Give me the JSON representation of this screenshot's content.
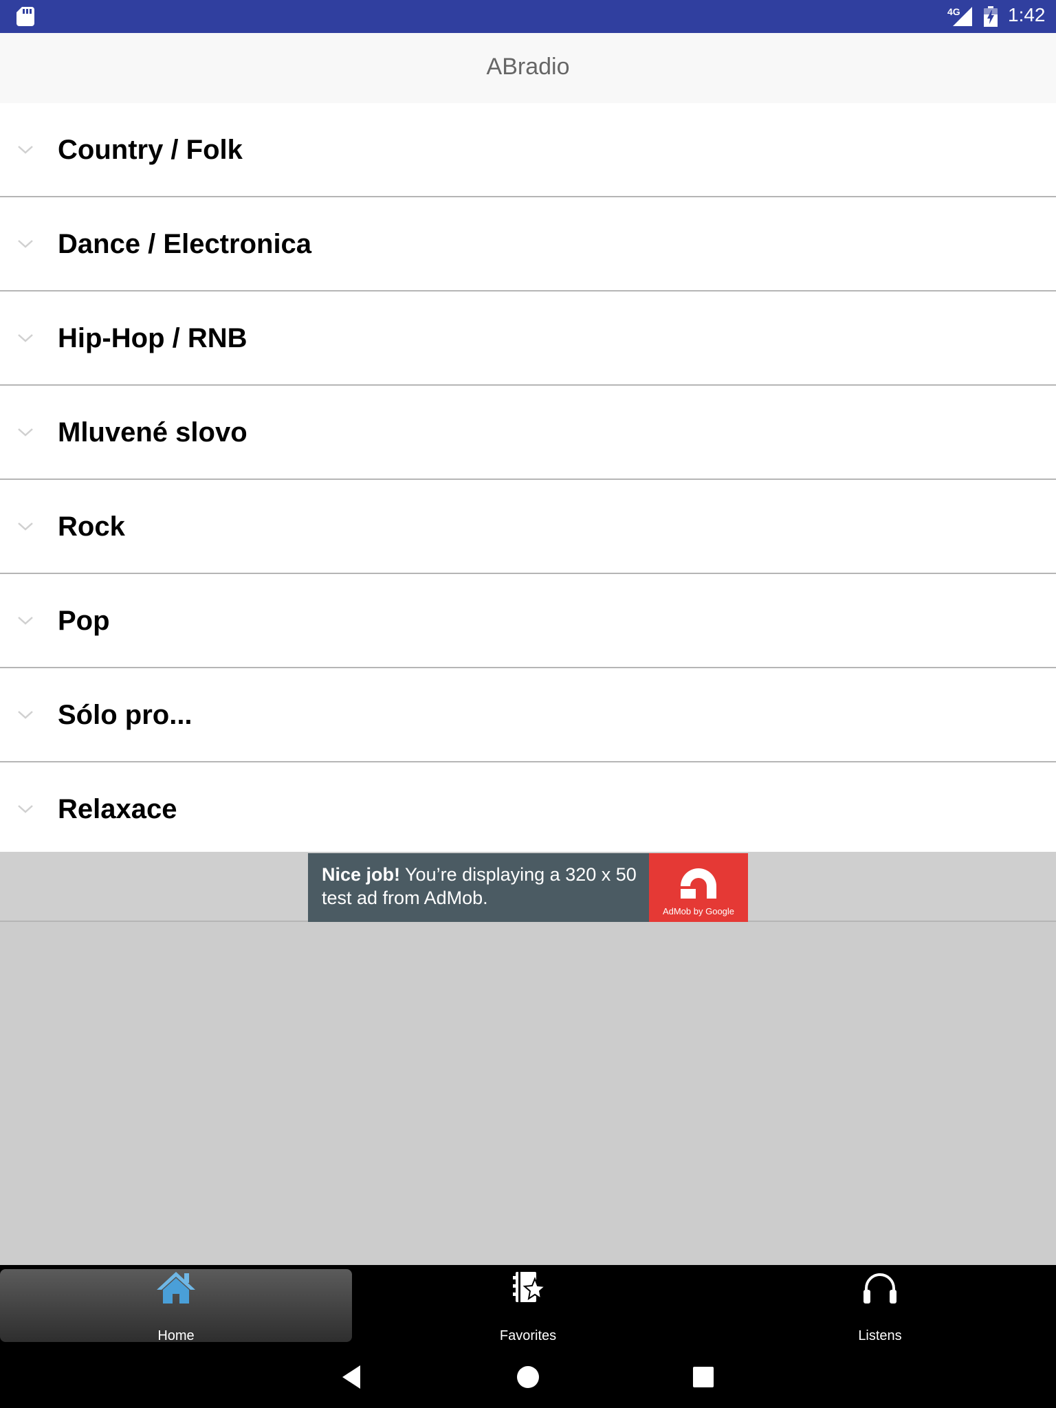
{
  "status_bar": {
    "network": "4G",
    "time": "1:42",
    "icons": [
      "sd-card-icon",
      "signal-icon",
      "battery-icon"
    ]
  },
  "app_bar": {
    "title": "ABradio"
  },
  "categories": [
    {
      "label": "Country / Folk"
    },
    {
      "label": "Dance / Electronica"
    },
    {
      "label": "Hip-Hop / RNB"
    },
    {
      "label": "Mluvené slovo"
    },
    {
      "label": "Rock"
    },
    {
      "label": "Pop"
    },
    {
      "label": "Sólo pro..."
    },
    {
      "label": "Relaxace"
    }
  ],
  "ad": {
    "headline": "Nice job!",
    "body": " You’re displaying a 320 x 50 test ad from AdMob.",
    "brand": "AdMob by Google",
    "brand_color": "#e53935",
    "background_color": "#4b5b63"
  },
  "tabs": [
    {
      "label": "Home",
      "icon": "home-icon",
      "active": true
    },
    {
      "label": "Favorites",
      "icon": "favorites-icon",
      "active": false
    },
    {
      "label": "Listens",
      "icon": "headphones-icon",
      "active": false
    }
  ],
  "nav_bar": {
    "buttons": [
      "back-icon",
      "home-circle-icon",
      "recents-icon"
    ]
  },
  "colors": {
    "status_bar": "#303f9f",
    "app_bar": "#f8f8f8",
    "content_background": "#cccccc",
    "tab_bar": "#000000"
  }
}
